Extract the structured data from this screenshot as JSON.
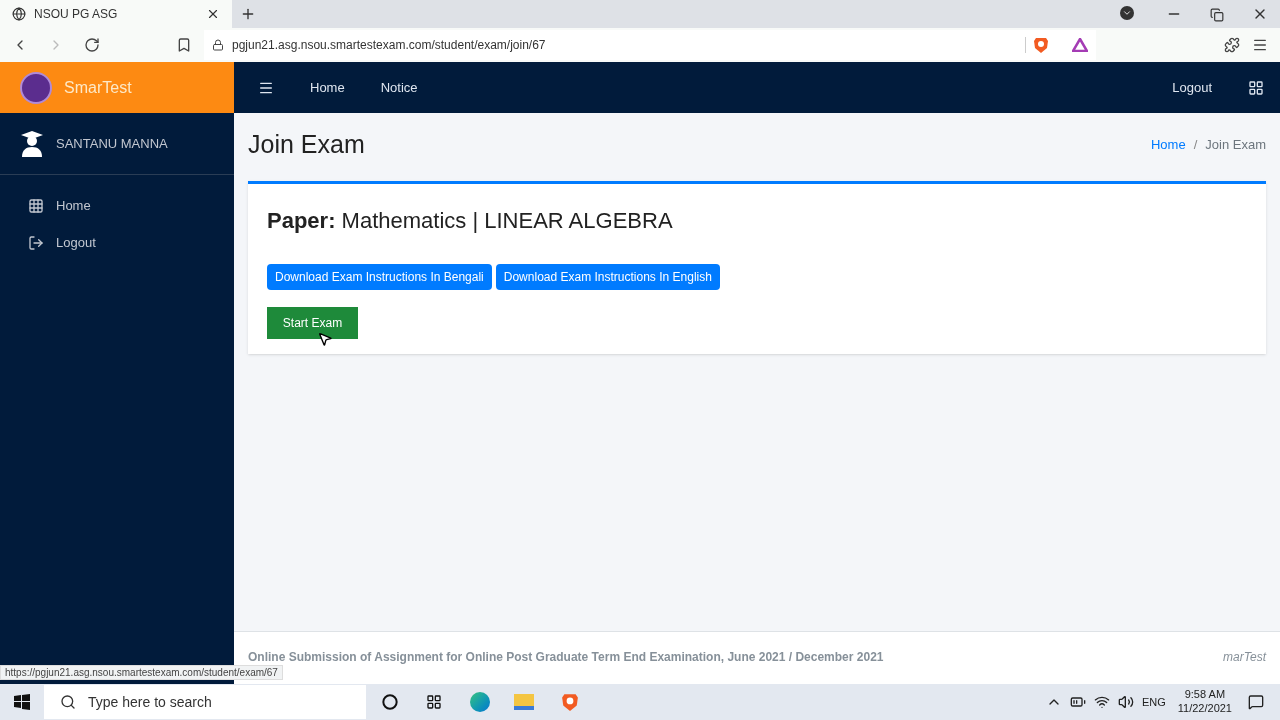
{
  "browser": {
    "tab_title": "NSOU PG ASG",
    "url": "pgjun21.asg.nsou.smartestexam.com/student/exam/join/67",
    "status_url": "https://pgjun21.asg.nsou.smartestexam.com/student/exam/67"
  },
  "brand": "SmarTest",
  "topnav": {
    "links": [
      "Home",
      "Notice"
    ],
    "logout": "Logout"
  },
  "sidebar": {
    "user": "SANTANU MANNA",
    "items": [
      {
        "label": "Home",
        "kind": "home"
      },
      {
        "label": "Logout",
        "kind": "logout"
      }
    ]
  },
  "page": {
    "title": "Join Exam",
    "breadcrumb": [
      "Home",
      "Join Exam"
    ],
    "breadcrumb_separator": "/"
  },
  "card": {
    "paper_label": "Paper:",
    "paper": "Mathematics | LINEAR ALGEBRA",
    "downloads": [
      "Download Exam Instructions In Bengali",
      "Download Exam Instructions In English"
    ],
    "start": "Start Exam"
  },
  "footer": {
    "text": "Online Submission of Assignment for Online Post Graduate Term End Examination, June 2021 / December 2021",
    "right": "marTest"
  },
  "taskbar": {
    "search_placeholder": "Type here to search",
    "lang": "ENG",
    "time": "9:58 AM",
    "date": "11/22/2021"
  }
}
